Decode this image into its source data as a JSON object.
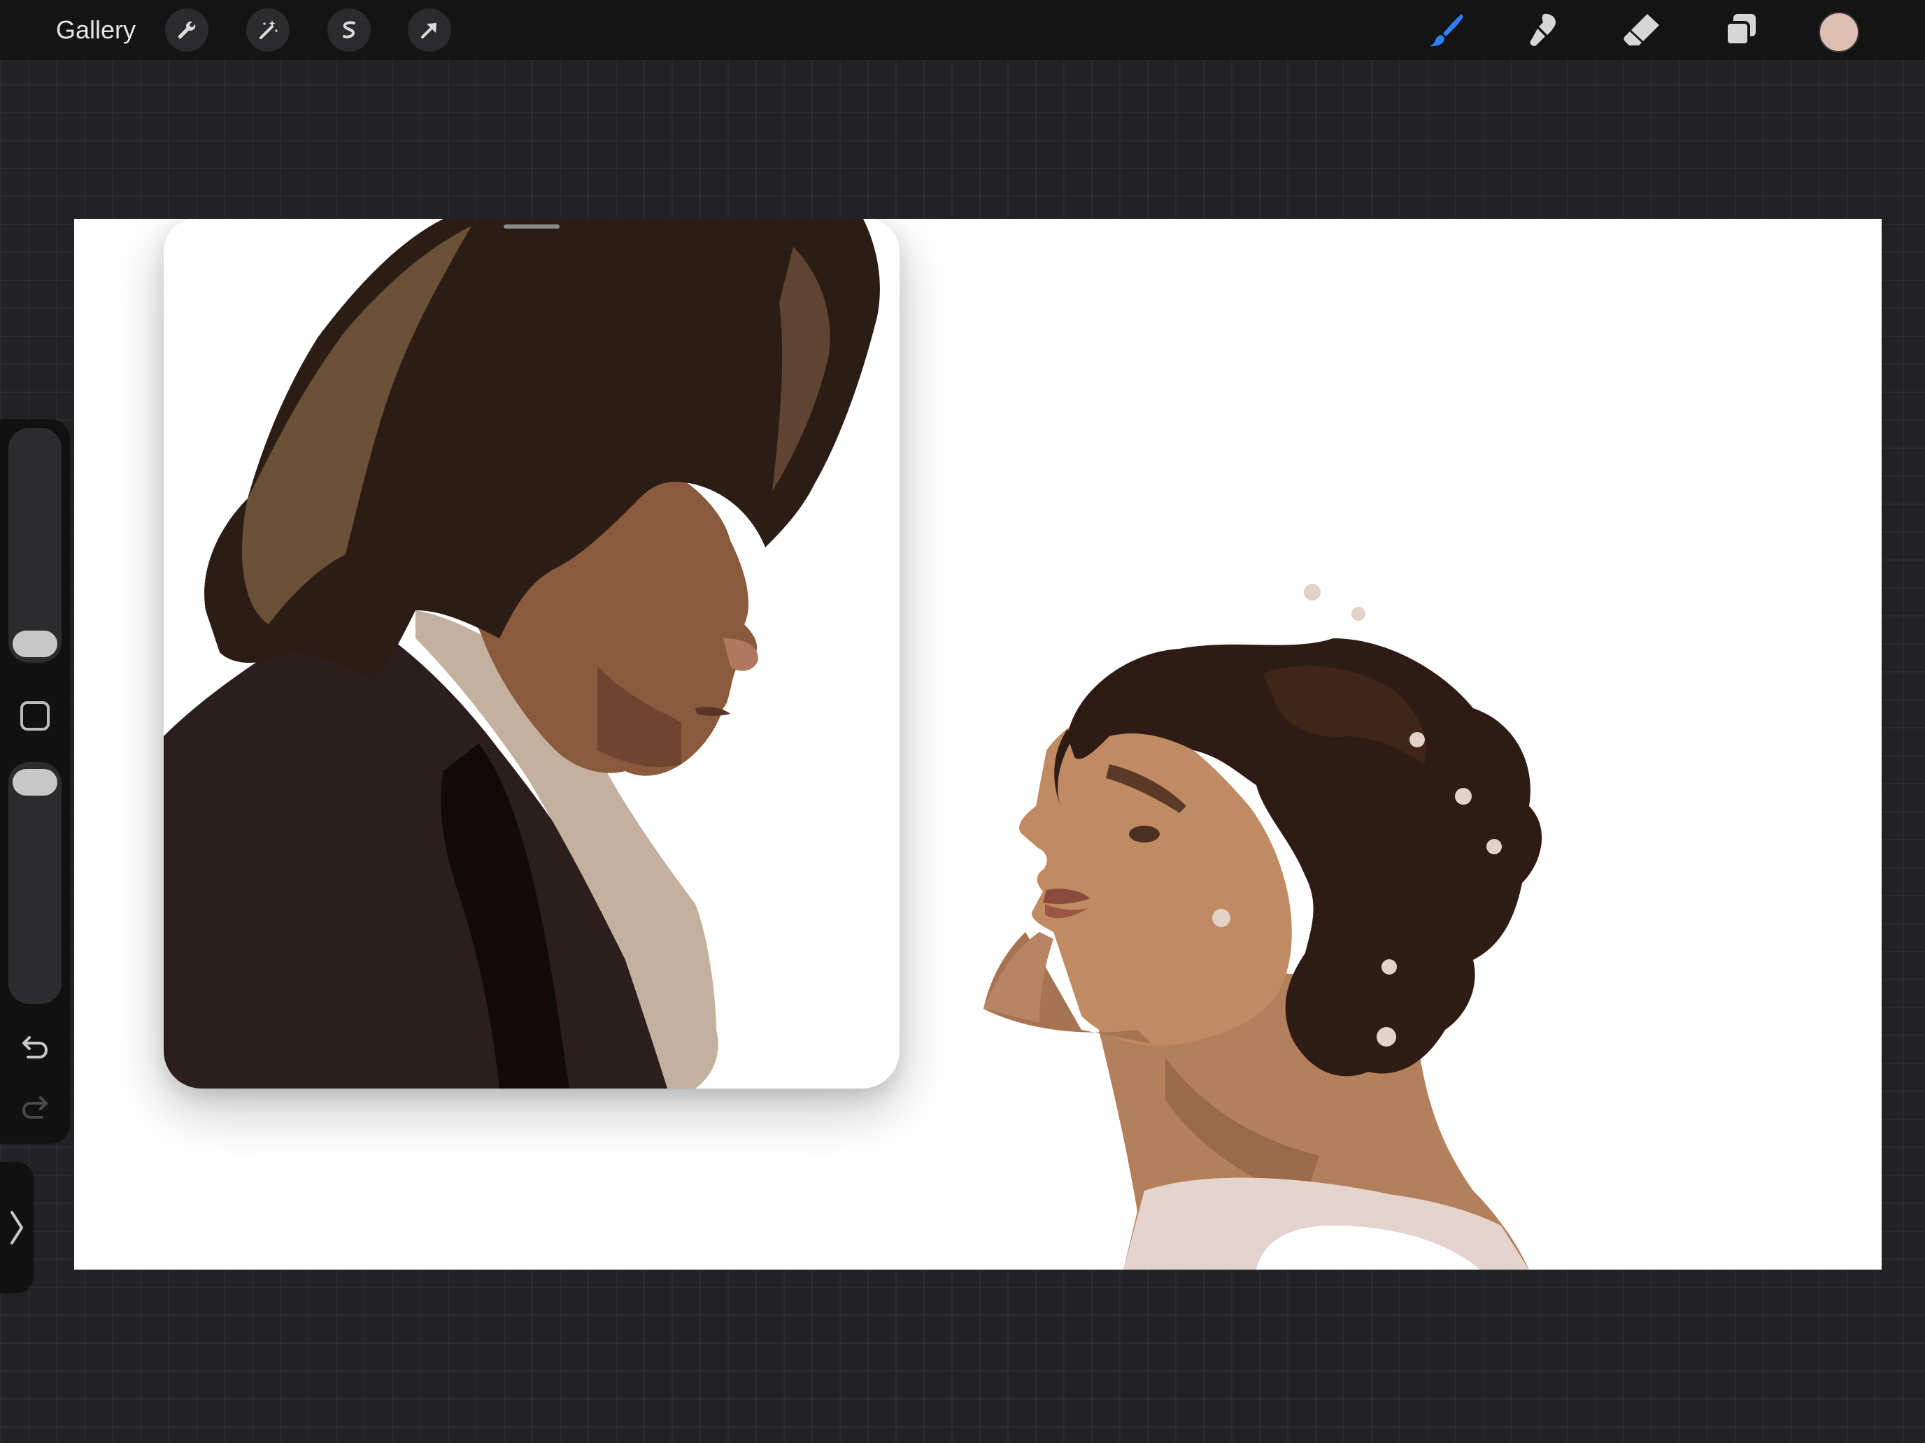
{
  "toolbar": {
    "gallery_label": "Gallery",
    "left_tools": [
      "actions-wrench-icon",
      "adjustments-magic-wand-icon",
      "selection-icon",
      "transform-arrow-icon"
    ],
    "right_tools": [
      "brush-icon",
      "smudge-icon",
      "eraser-icon",
      "layers-icon"
    ],
    "active_tool": "brush-icon"
  },
  "colors": {
    "accent": "#2f7ff5",
    "current_color": "#dcbfb2"
  },
  "sidebar": {
    "brush_size_level": 0.05,
    "opacity_level": 0.97,
    "icons": [
      "modify-square-icon",
      "undo-icon",
      "redo-icon"
    ]
  },
  "reference": {
    "visible": true
  }
}
